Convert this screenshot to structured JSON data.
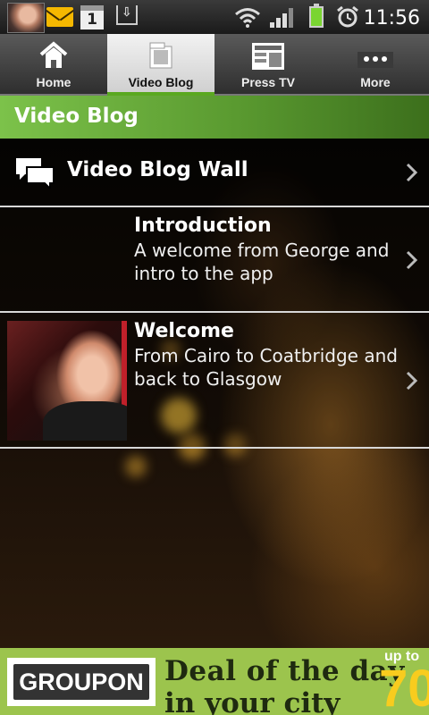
{
  "status_bar": {
    "time": "11:56",
    "calendar_day": "1"
  },
  "tabs": [
    {
      "label": "Home",
      "icon": "home-icon"
    },
    {
      "label": "Video Blog",
      "icon": "film-icon",
      "active": true
    },
    {
      "label": "Press TV",
      "icon": "newspaper-icon"
    },
    {
      "label": "More",
      "icon": "more-icon"
    }
  ],
  "section": {
    "title": "Video Blog"
  },
  "list": {
    "wall": {
      "label": "Video Blog Wall"
    },
    "items": [
      {
        "title": "Introduction",
        "desc_line1": "A welcome from George and",
        "desc_line2": "intro to the app"
      },
      {
        "title": "Welcome",
        "desc_line1": "From Cairo to Coatbridge and",
        "desc_line2": "back to Glasgow"
      }
    ]
  },
  "ad": {
    "brand": "GROUPON",
    "line1": "Deal of the day",
    "line2": "in your city",
    "upto": "up to",
    "percent": "70"
  },
  "colors": {
    "accent_green": "#5aa820",
    "header_green": "#7cc24a",
    "ad_green": "#9cc44d"
  }
}
